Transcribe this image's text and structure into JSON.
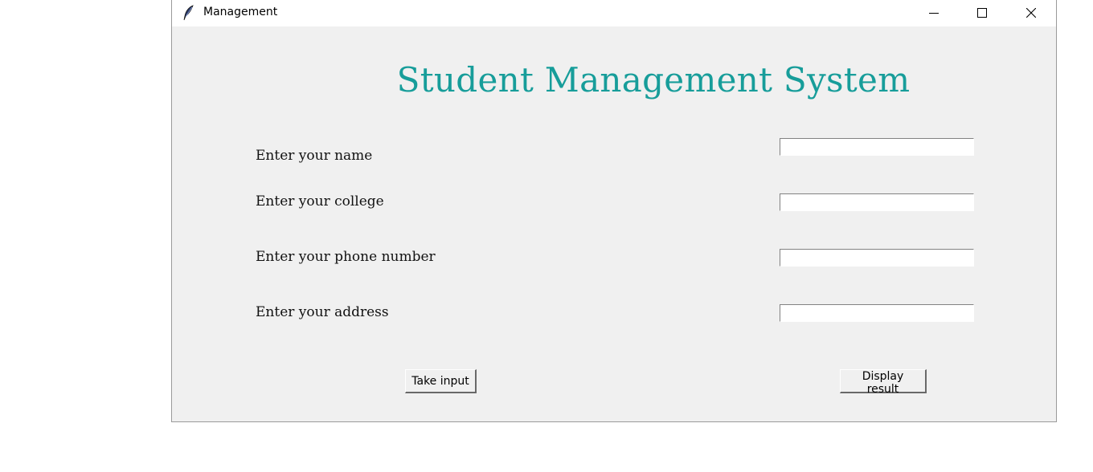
{
  "window": {
    "title": "Management",
    "controls": {
      "minimize": "minimize-icon",
      "maximize": "maximize-icon",
      "close": "close-icon"
    }
  },
  "main": {
    "heading": "Student Management System",
    "heading_color": "#179d9a",
    "fields": [
      {
        "label": "Enter your name",
        "value": ""
      },
      {
        "label": "Enter your college",
        "value": ""
      },
      {
        "label": "Enter your phone number",
        "value": ""
      },
      {
        "label": "Enter your address",
        "value": ""
      }
    ],
    "buttons": {
      "take_input": "Take input",
      "display_result": "Display result"
    }
  }
}
